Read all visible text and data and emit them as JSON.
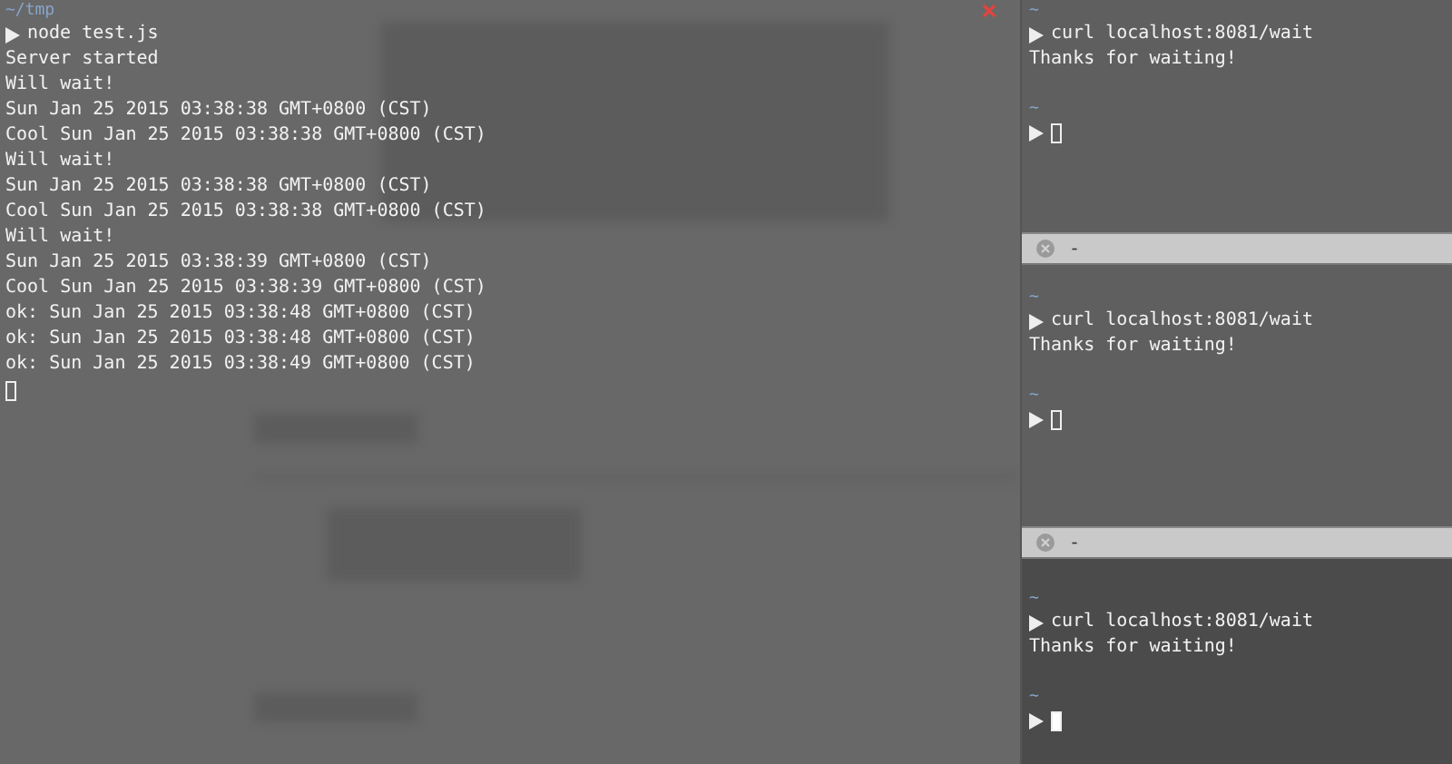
{
  "left_terminal": {
    "focused": false,
    "directory": "~/tmp",
    "command": "node test.js",
    "output": [
      "Server started",
      "Will wait!",
      "Sun Jan 25 2015 03:38:38 GMT+0800 (CST)",
      "Cool Sun Jan 25 2015 03:38:38 GMT+0800 (CST)",
      "Will wait!",
      "Sun Jan 25 2015 03:38:38 GMT+0800 (CST)",
      "Cool Sun Jan 25 2015 03:38:38 GMT+0800 (CST)",
      "Will wait!",
      "Sun Jan 25 2015 03:38:39 GMT+0800 (CST)",
      "Cool Sun Jan 25 2015 03:38:39 GMT+0800 (CST)",
      "ok: Sun Jan 25 2015 03:38:48 GMT+0800 (CST)",
      "ok: Sun Jan 25 2015 03:38:48 GMT+0800 (CST)",
      "ok: Sun Jan 25 2015 03:38:49 GMT+0800 (CST)"
    ]
  },
  "right_panes": [
    {
      "focused": false,
      "sessions": [
        {
          "directory": "~",
          "command": "curl localhost:8081/wait",
          "output": [
            "Thanks for waiting!"
          ]
        },
        {
          "directory": "~"
        }
      ]
    },
    {
      "focused": false,
      "tab": {
        "title": "-"
      },
      "sessions": [
        {
          "directory": "~",
          "command": "curl localhost:8081/wait",
          "output": [
            "Thanks for waiting!"
          ]
        },
        {
          "directory": "~"
        }
      ]
    },
    {
      "focused": true,
      "tab": {
        "title": "-"
      },
      "sessions": [
        {
          "directory": "~",
          "command": "curl localhost:8081/wait",
          "output": [
            "Thanks for waiting!"
          ]
        },
        {
          "directory": "~"
        }
      ]
    }
  ]
}
